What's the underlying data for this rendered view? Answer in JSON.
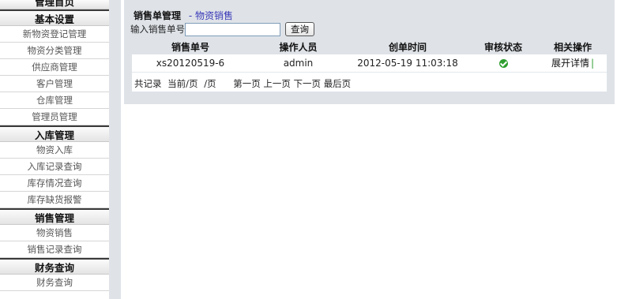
{
  "sidebar": {
    "top_header": "管理首页",
    "groups": [
      {
        "title": "基本设置",
        "items": [
          "新物资登记管理",
          "物资分类管理",
          "供应商管理",
          "客户管理",
          "仓库管理",
          "管理员管理"
        ]
      },
      {
        "title": "入库管理",
        "items": [
          "物资入库",
          "入库记录查询",
          "库存情况查询",
          "库存缺货报警"
        ]
      },
      {
        "title": "销售管理",
        "items": [
          "物资销售",
          "销售记录查询"
        ]
      },
      {
        "title": "财务查询",
        "items": [
          "财务查询"
        ]
      }
    ]
  },
  "page": {
    "title": "销售单管理",
    "subtitle": "- 物资销售"
  },
  "search": {
    "label": "输入销售单号",
    "value": "",
    "button": "查询"
  },
  "table": {
    "headers": [
      "销售单号",
      "操作人员",
      "创单时间",
      "审核状态",
      "相关操作"
    ],
    "rows": [
      {
        "order_no": "xs20120519-6",
        "operator": "admin",
        "created": "2012-05-19 11:03:18",
        "status_icon": "check-circle-icon",
        "action": "展开详情",
        "separator": "|"
      }
    ]
  },
  "pager": {
    "total": "共记录",
    "current": "当前/页",
    "pages": "/页",
    "first": "第一页",
    "prev": "上一页",
    "next": "下一页",
    "last": "最后页"
  }
}
